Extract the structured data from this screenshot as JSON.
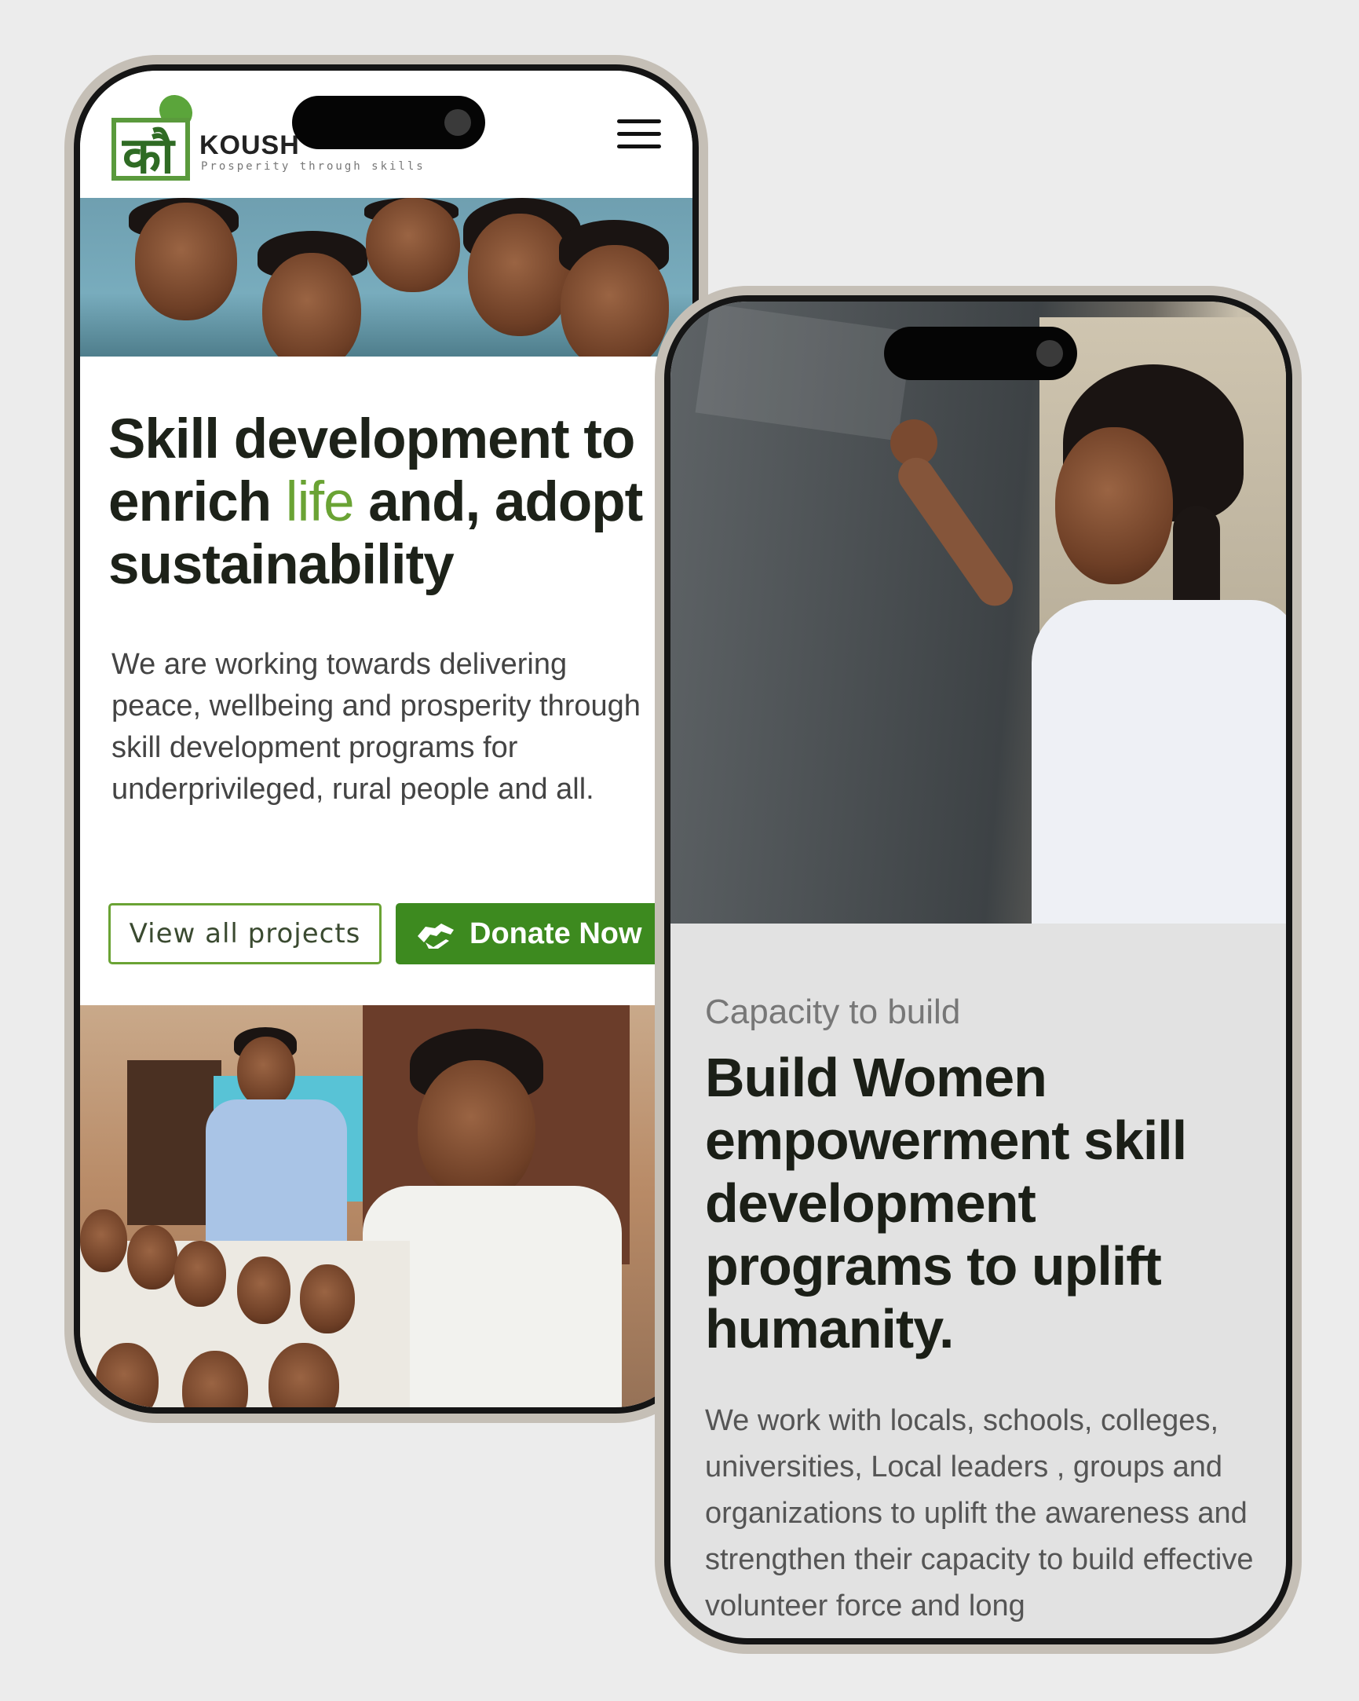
{
  "left_phone": {
    "logo": {
      "name": "KOUSH",
      "tagline": "Prosperity through skills",
      "mark_letter": "कौ"
    },
    "hero": {
      "title_part1": "Skill development to enrich ",
      "title_accent": "life",
      "title_part2": "  and, adopt sustainability",
      "description": "We are working towards delivering peace, wellbeing and prosperity through skill development programs for underprivileged, rural people and all."
    },
    "buttons": {
      "view_projects": "View all projects",
      "donate": "Donate Now"
    }
  },
  "right_phone": {
    "eyebrow": "Capacity to build",
    "title": "Build Women empowerment skill development programs to uplift humanity.",
    "description": "We work with locals, schools, colleges, universities, Local leaders , groups and organizations to uplift the awareness and strengthen their capacity to build effective volunteer force and long"
  },
  "colors": {
    "accent_green": "#6aa334",
    "button_green": "#3d8a1f",
    "background": "#ececec",
    "frame": "#c5bfb6"
  },
  "icons": [
    "menu-icon",
    "handshake-icon",
    "camera-icon"
  ]
}
